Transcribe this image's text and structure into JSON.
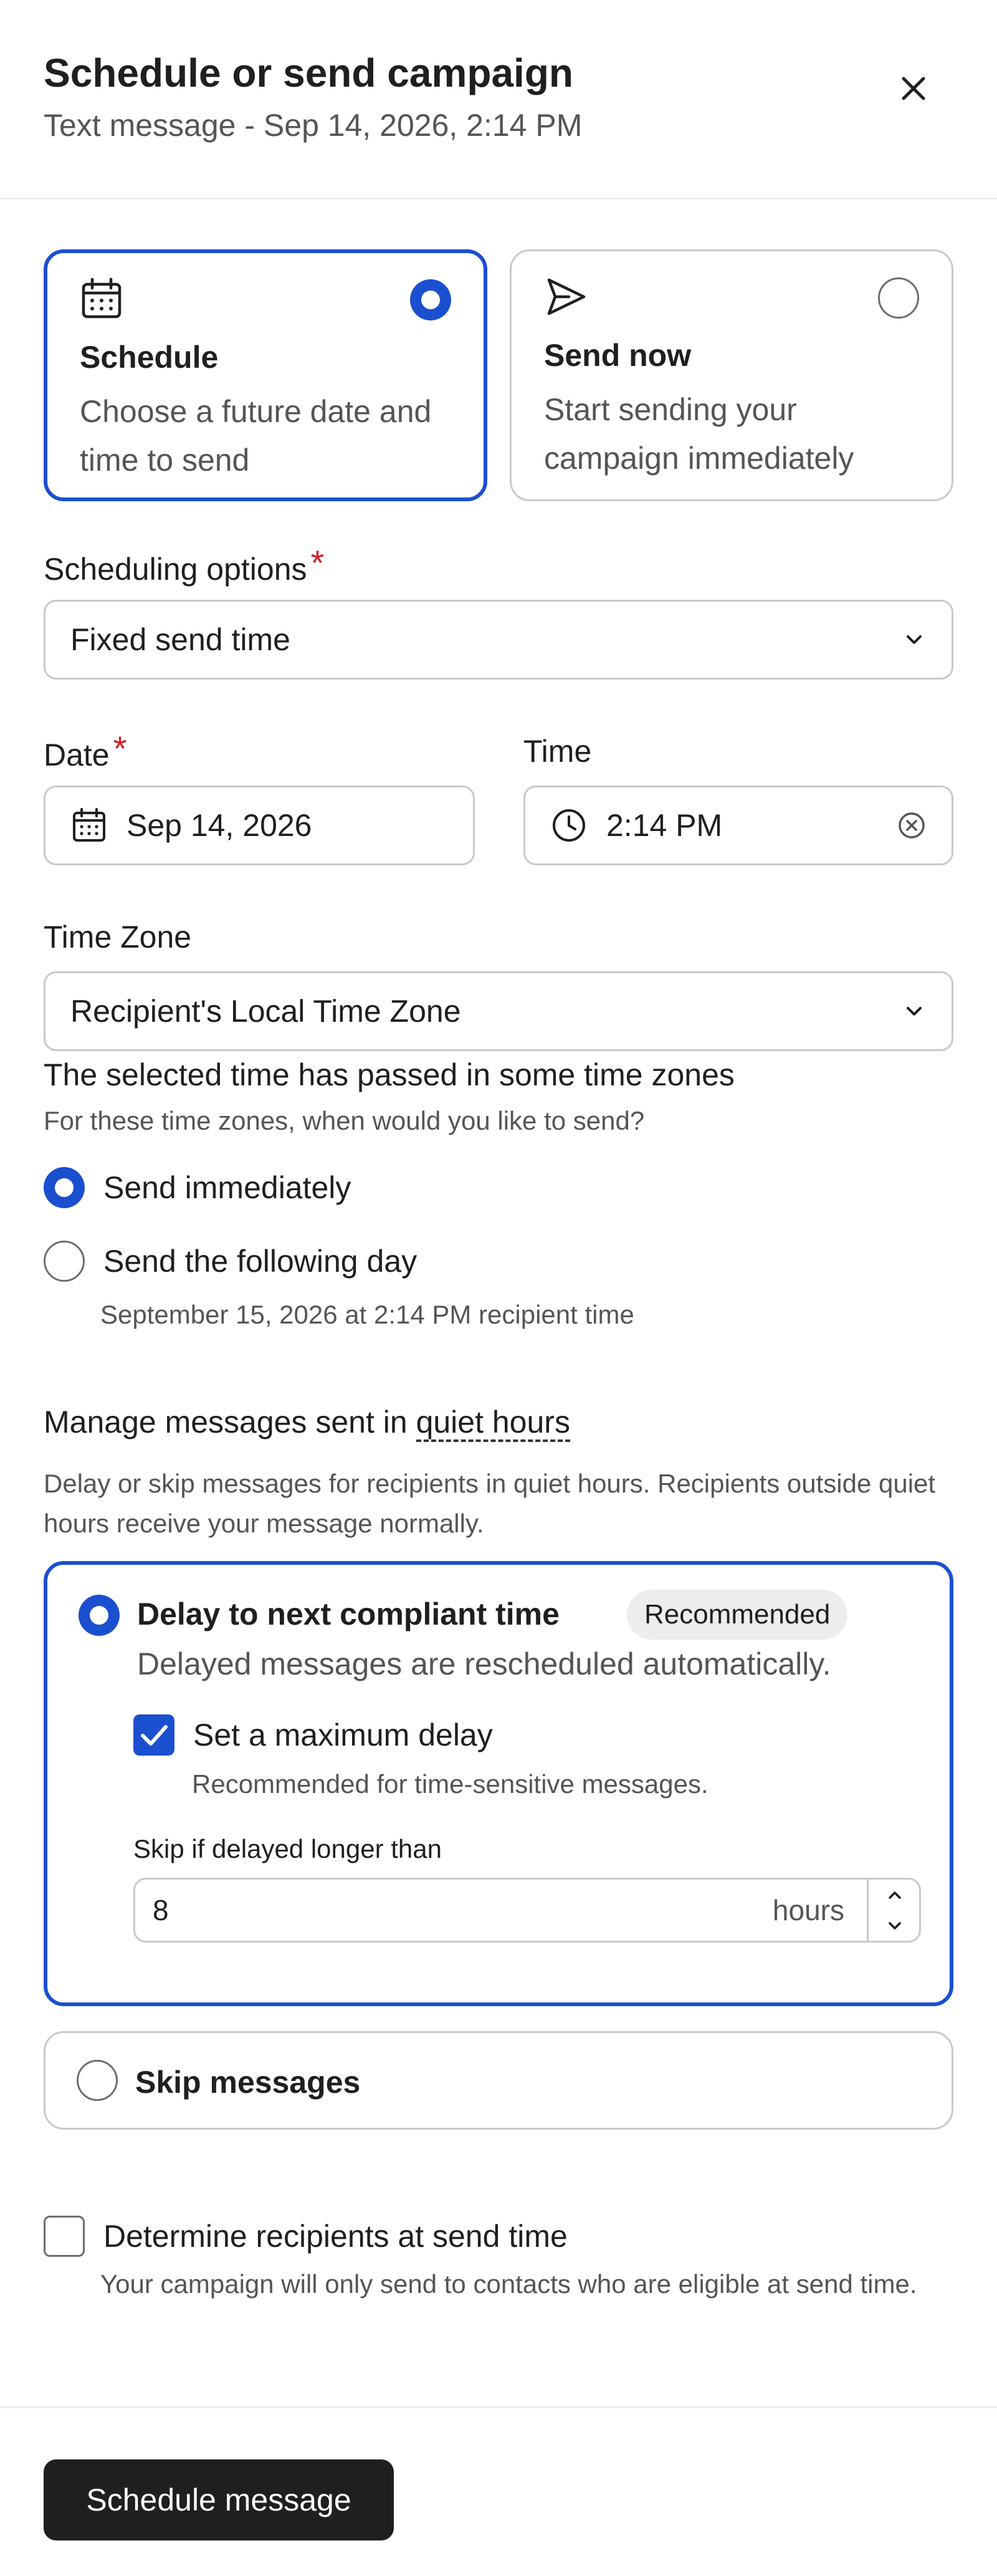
{
  "header": {
    "title": "Schedule or send campaign",
    "subtitle": "Text message - Sep 14, 2026, 2:14 PM"
  },
  "mode_cards": [
    {
      "title": "Schedule",
      "description": "Choose a future date and time to send",
      "selected": true,
      "icon": "calendar-icon"
    },
    {
      "title": "Send now",
      "description": "Start sending your campaign immediately",
      "selected": false,
      "icon": "send-icon"
    }
  ],
  "scheduling_options": {
    "label": "Scheduling options",
    "required_mark": "*",
    "value": "Fixed send time"
  },
  "date": {
    "label": "Date",
    "required_mark": "*",
    "value": "Sep 14, 2026"
  },
  "time": {
    "label": "Time",
    "value": "2:14 PM"
  },
  "time_zone": {
    "label": "Time Zone",
    "value": "Recipient's Local Time Zone"
  },
  "passed_time": {
    "title": "The selected time has passed in some time zones",
    "question": "For these time zones, when would you like to send?",
    "options": [
      {
        "label": "Send immediately",
        "selected": true
      },
      {
        "label": "Send the following day",
        "selected": false,
        "sub": "September 15, 2026 at 2:14 PM recipient time"
      }
    ]
  },
  "quiet_hours": {
    "title_prefix": "Manage messages sent in ",
    "title_link": "quiet hours",
    "description": "Delay or skip messages for recipients in quiet hours. Recipients outside quiet hours receive your message normally.",
    "delay_option": {
      "title": "Delay to next compliant time",
      "badge": "Recommended",
      "description": "Delayed messages are rescheduled automatically.",
      "selected": true,
      "max_delay": {
        "label": "Set a maximum delay",
        "checked": true,
        "sub": "Recommended for time-sensitive messages."
      },
      "skip_label": "Skip if delayed longer than",
      "skip_value": "8",
      "skip_unit": "hours"
    },
    "skip_option": {
      "title": "Skip messages",
      "selected": false
    }
  },
  "determine_recipients": {
    "label": "Determine recipients at send time",
    "checked": false,
    "sub": "Your campaign will only send to contacts who are eligible at send time."
  },
  "footer": {
    "primary_button": "Schedule message"
  },
  "colors": {
    "accent": "#1a4fd0",
    "required": "#d0202a",
    "button": "#1f1f1f"
  }
}
